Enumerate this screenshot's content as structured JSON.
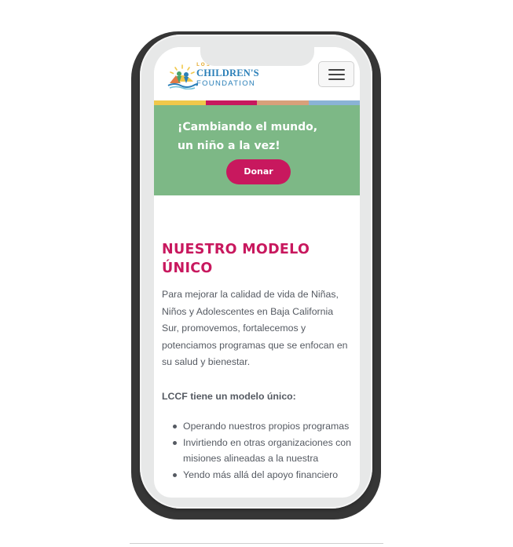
{
  "logo": {
    "small_text": "LOS CABOS",
    "main_text": "CHILDREN'S",
    "sub_text": "FOUNDATION"
  },
  "header": {
    "menu_icon": "hamburger-menu-icon"
  },
  "stripe_colors": [
    "#f1c84b",
    "#c8185e",
    "#d8a07a",
    "#8ab3d6"
  ],
  "hero": {
    "title_line1": "¡Cambiando el mundo,",
    "title_line2": "un niño a la vez!",
    "donate_label": "Donar",
    "background": "#7db886",
    "button_color": "#c8185e"
  },
  "main": {
    "title_line1": "NUESTRO MODELO",
    "title_line2": "ÚNICO",
    "paragraph": "Para mejorar la calidad de vida de Niñas, Niños y Adolescentes en Baja California Sur, promovemos, fortalecemos y potenciamos programas que se enfocan en su salud y bienestar.",
    "subheading": "LCCF tiene un modelo único:",
    "bullets": [
      "Operando nuestros propios programas",
      "Invirtiendo en otras organizaciones con misiones alineadas a la nuestra",
      "Yendo más allá del apoyo financiero"
    ]
  }
}
